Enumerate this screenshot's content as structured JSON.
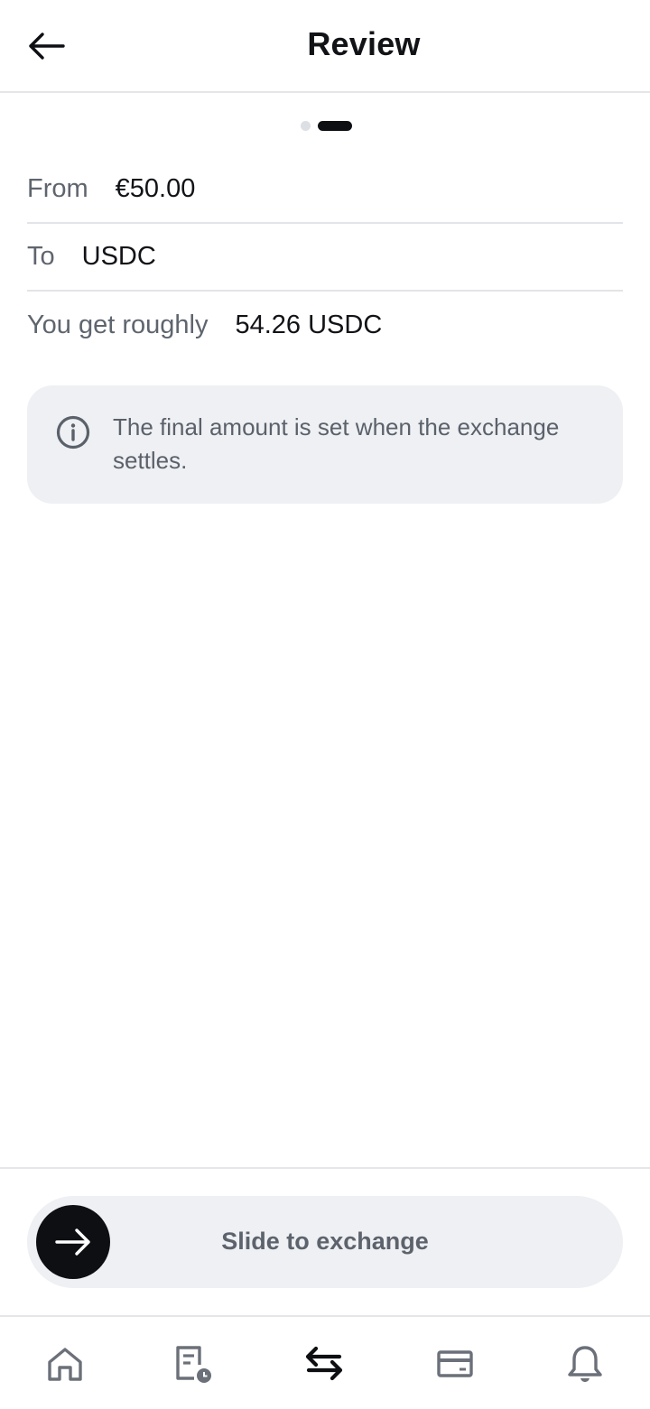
{
  "header": {
    "title": "Review",
    "back_icon": "arrow-left-icon"
  },
  "stepper": {
    "total_steps": 2,
    "current_step": 2
  },
  "summary": {
    "from": {
      "label": "From",
      "value": "€50.00"
    },
    "to": {
      "label": "To",
      "value": "USDC"
    },
    "estimate": {
      "label": "You get roughly",
      "value": "54.26 USDC"
    }
  },
  "notice": {
    "icon": "info-icon",
    "text": "The final amount is set when the exchange settles."
  },
  "slider": {
    "label": "Slide to exchange",
    "knob_icon": "arrow-right-icon"
  },
  "bottom_nav": {
    "items": [
      {
        "icon": "home-icon",
        "active": false
      },
      {
        "icon": "activity-icon",
        "active": false
      },
      {
        "icon": "exchange-icon",
        "active": true
      },
      {
        "icon": "card-icon",
        "active": false
      },
      {
        "icon": "bell-icon",
        "active": false
      }
    ]
  },
  "colors": {
    "primary": "#0d0f12",
    "muted_text": "#5f656e",
    "surface": "#eef0f3",
    "nav_inactive": "#6b7079"
  }
}
